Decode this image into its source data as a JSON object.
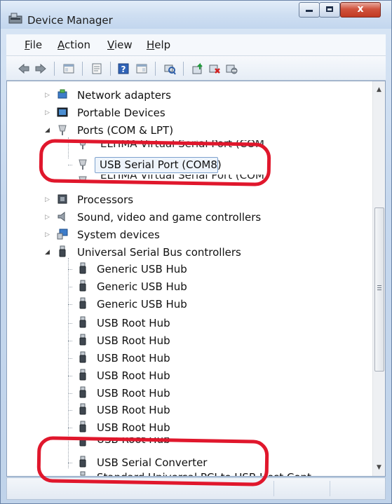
{
  "window": {
    "title": "Device Manager",
    "close_glyph": "x"
  },
  "menu": [
    {
      "label_u": "F",
      "label_rest": "ile"
    },
    {
      "label_u": "A",
      "label_rest": "ction"
    },
    {
      "label_u": "V",
      "label_rest": "iew"
    },
    {
      "label_u": "H",
      "label_rest": "elp"
    }
  ],
  "toolbar": {
    "icons": [
      "back-arrow-icon",
      "forward-arrow-icon",
      "show-hide-console-tree-icon",
      "properties-icon",
      "help-icon",
      "action-pane-icon",
      "scan-hardware-changes-icon",
      "update-driver-icon",
      "uninstall-icon",
      "disable-icon"
    ]
  },
  "tree": {
    "network_adapters": "Network adapters",
    "portable_devices": "Portable Devices",
    "ports": "Ports (COM & LPT)",
    "eltima_port": "ELTIMA Virtual Serial Port (COM",
    "usb_serial_port": "USB Serial Port (COM8)",
    "obscured_port": "ELTIMA Virtual Serial Port (COM",
    "processors": "Processors",
    "sound": "Sound, video and game controllers",
    "system_devices": "System devices",
    "usb_controllers": "Universal Serial Bus controllers",
    "usb_children": [
      "Generic USB Hub",
      "Generic USB Hub",
      "Generic USB Hub",
      "USB Root Hub",
      "USB Root Hub",
      "USB Root Hub",
      "USB Root Hub",
      "USB Root Hub",
      "USB Root Hub",
      "USB Root Hub",
      "USB Root Hub",
      "USB Serial Converter",
      "Standard Universal PCI to USB Host Controller"
    ]
  },
  "colors": {
    "annotation": "#e0172c",
    "titlebar": "#cfdff2",
    "selection": "#eef4fb"
  }
}
